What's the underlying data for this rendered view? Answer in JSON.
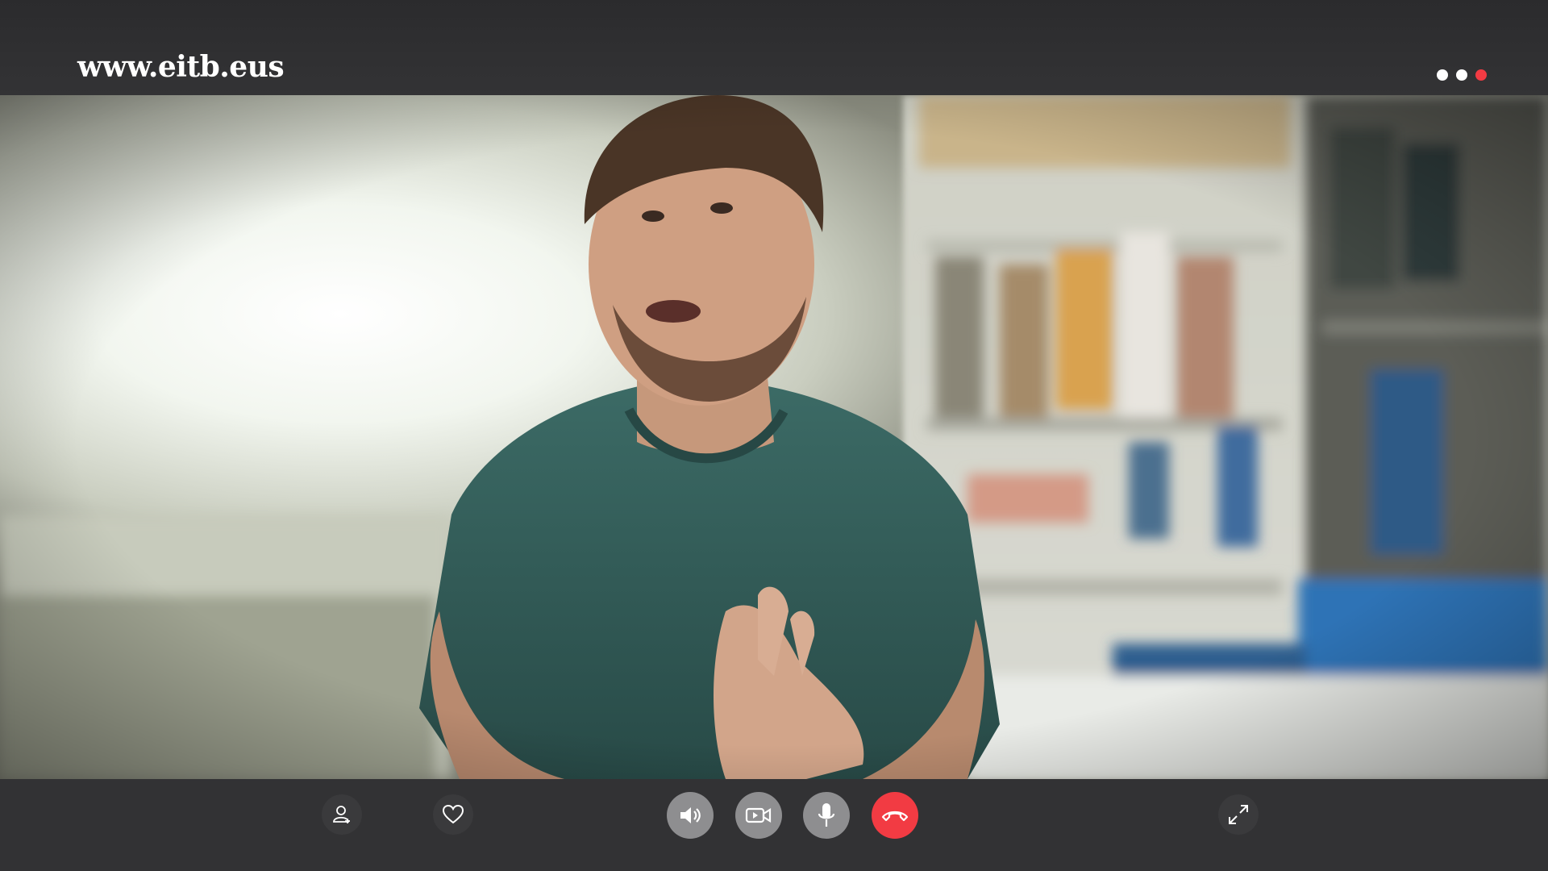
{
  "app": {
    "brand": "www.eitb.eus"
  },
  "window_dots": [
    {
      "name": "dot-white-1",
      "color": "#ffffff"
    },
    {
      "name": "dot-white-2",
      "color": "#ffffff"
    },
    {
      "name": "dot-red",
      "color": "#f23b43"
    }
  ],
  "controls": {
    "add_participant": {
      "icon": "add-user-icon"
    },
    "favorite": {
      "icon": "heart-icon"
    },
    "speaker": {
      "icon": "speaker-icon"
    },
    "camera": {
      "icon": "video-camera-icon"
    },
    "microphone": {
      "icon": "microphone-icon"
    },
    "hang_up": {
      "icon": "phone-hangup-icon",
      "color": "#f23b43"
    },
    "fullscreen": {
      "icon": "expand-icon"
    }
  },
  "video": {
    "content": "remote-participant-feed"
  }
}
